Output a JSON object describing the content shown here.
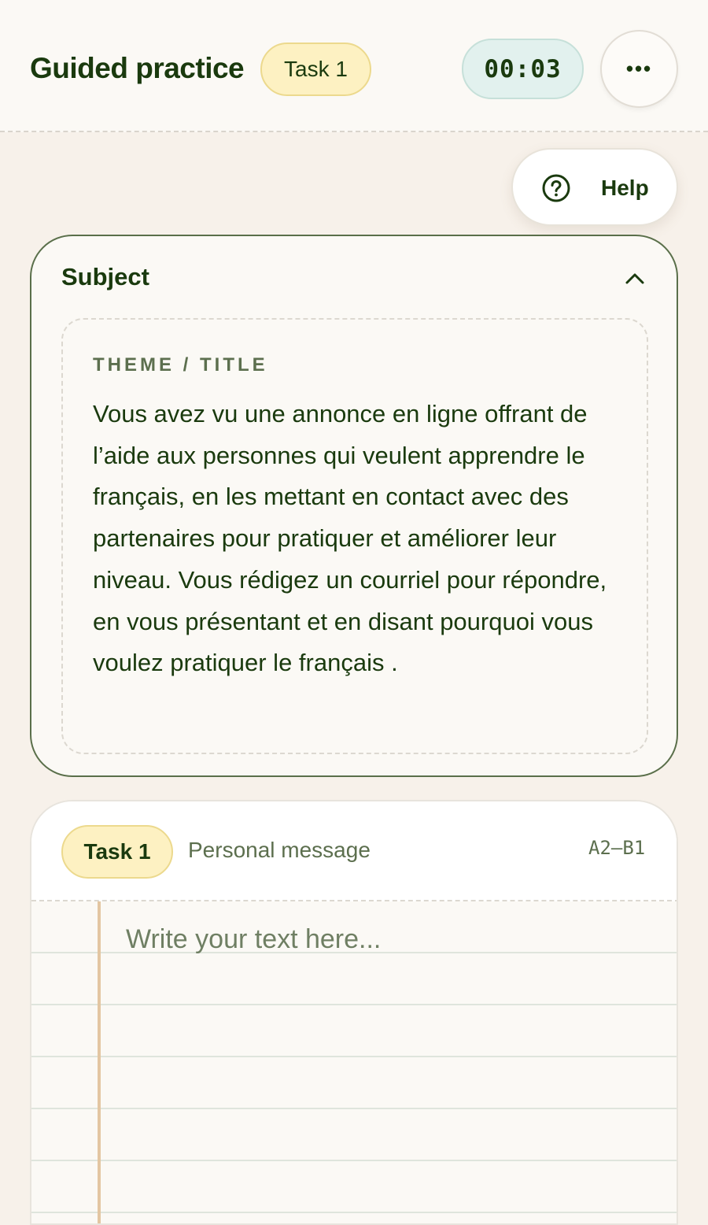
{
  "header": {
    "title": "Guided practice",
    "task_pill": "Task 1",
    "timer": "00:03",
    "more_label": "•••"
  },
  "help": {
    "label": "Help",
    "icon": "question-circle-icon"
  },
  "subject": {
    "title": "Subject",
    "toggle_icon": "chevron-up-icon",
    "theme_label": "THEME / TITLE",
    "theme_text": "Vous avez vu une annonce en ligne offrant de l’aide aux personnes qui veulent apprendre le français, en les mettant en contact avec des partenaires pour pratiquer et améliorer leur niveau. Vous rédigez un courriel pour répondre, en vous présentant et en disant pourquoi vous voulez pratiquer le français ."
  },
  "task_card": {
    "pill": "Task 1",
    "type": "Personal message",
    "level": "A2–B1",
    "input_value": "",
    "input_placeholder": "Write your text here..."
  },
  "colors": {
    "primary_text": "#1a3a0e",
    "task_pill_bg": "#fdf1c2",
    "timer_bg": "#e2f1ee",
    "margin_line": "#e3c6a2",
    "card_border": "#5a6f4a"
  }
}
